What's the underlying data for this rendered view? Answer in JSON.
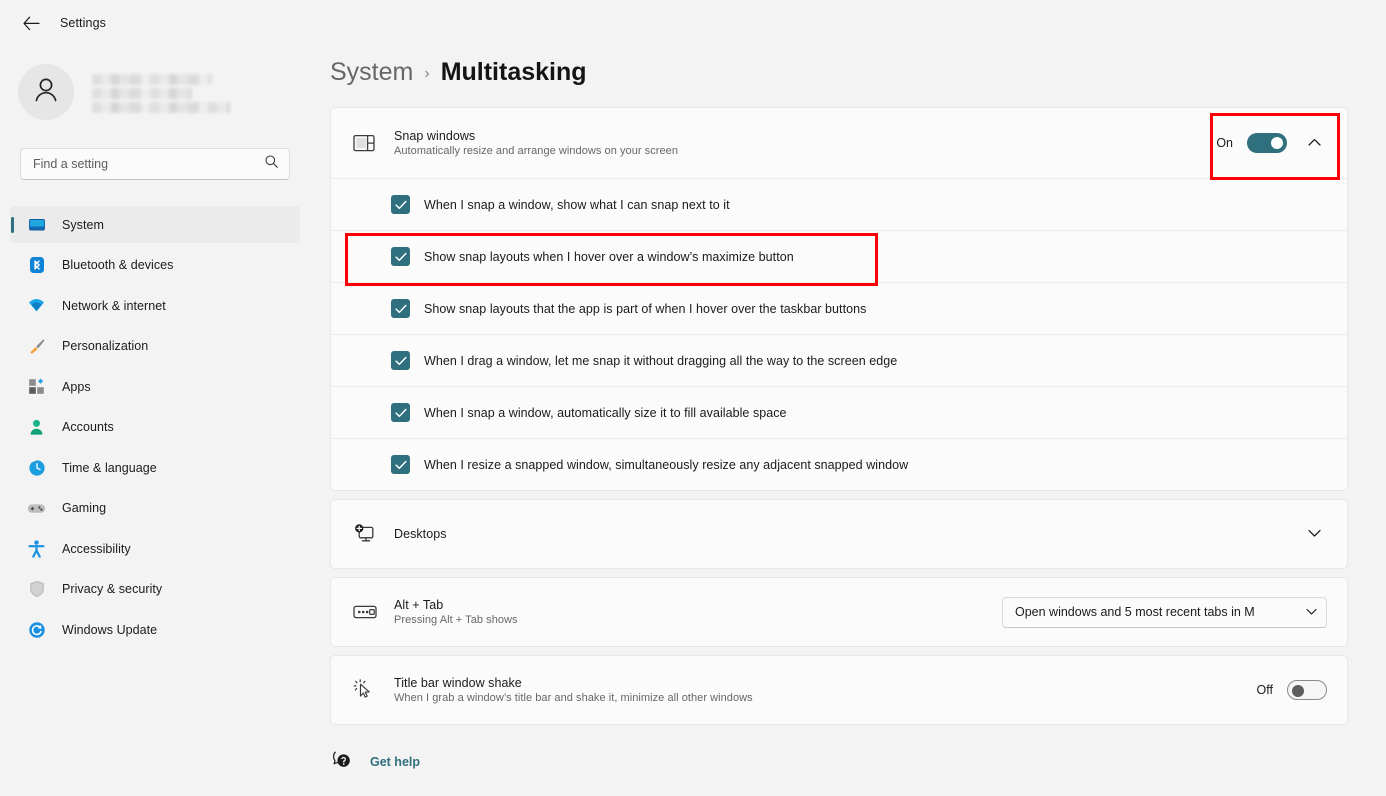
{
  "titlebar": {
    "back_icon": "arrow-left-icon",
    "title": "Settings"
  },
  "sidebar": {
    "profile": {
      "avatar_icon": "person-avatar-icon",
      "name_redacted": true
    },
    "search": {
      "placeholder": "Find a setting",
      "value": "",
      "icon": "search-icon"
    },
    "items": [
      {
        "label": "System",
        "icon": "monitor-icon",
        "selected": true
      },
      {
        "label": "Bluetooth & devices",
        "icon": "bluetooth-icon",
        "selected": false
      },
      {
        "label": "Network & internet",
        "icon": "wifi-icon",
        "selected": false
      },
      {
        "label": "Personalization",
        "icon": "paintbrush-icon",
        "selected": false
      },
      {
        "label": "Apps",
        "icon": "apps-grid-icon",
        "selected": false
      },
      {
        "label": "Accounts",
        "icon": "person-icon",
        "selected": false
      },
      {
        "label": "Time & language",
        "icon": "clock-icon",
        "selected": false
      },
      {
        "label": "Gaming",
        "icon": "gamepad-icon",
        "selected": false
      },
      {
        "label": "Accessibility",
        "icon": "accessibility-icon",
        "selected": false
      },
      {
        "label": "Privacy & security",
        "icon": "shield-icon",
        "selected": false
      },
      {
        "label": "Windows Update",
        "icon": "update-icon",
        "selected": false
      }
    ]
  },
  "breadcrumb": {
    "parent": "System",
    "separator": "›",
    "current": "Multitasking"
  },
  "snap": {
    "icon": "snap-layout-icon",
    "title": "Snap windows",
    "subtitle": "Automatically resize and arrange windows on your screen",
    "toggle_state": "On",
    "toggle_on": true,
    "expand_icon": "chevron-up-icon",
    "options": [
      {
        "label": "When I snap a window, show what I can snap next to it",
        "checked": true
      },
      {
        "label": "Show snap layouts when I hover over a window’s maximize button",
        "checked": true
      },
      {
        "label": "Show snap layouts that the app is part of when I hover over the taskbar buttons",
        "checked": true
      },
      {
        "label": "When I drag a window, let me snap it without dragging all the way to the screen edge",
        "checked": true
      },
      {
        "label": "When I snap a window, automatically size it to fill available space",
        "checked": true
      },
      {
        "label": "When I resize a snapped window, simultaneously resize any adjacent snapped window",
        "checked": true
      }
    ]
  },
  "desktops": {
    "icon": "desktops-icon",
    "title": "Desktops",
    "expand_icon": "chevron-down-icon"
  },
  "alttab": {
    "icon": "alt-tab-icon",
    "title": "Alt + Tab",
    "subtitle": "Pressing Alt + Tab shows",
    "dropdown_value": "Open windows and 5 most recent tabs in M",
    "dropdown_icon": "chevron-down-icon"
  },
  "shake": {
    "icon": "cursor-shake-icon",
    "title": "Title bar window shake",
    "subtitle": "When I grab a window’s title bar and shake it, minimize all other windows",
    "toggle_state": "Off",
    "toggle_on": false
  },
  "gethelp": {
    "icon": "help-bubble-icon",
    "label": "Get help"
  },
  "annotations": [
    {
      "name": "snap-toggle-highlight",
      "color": "#fb0007"
    },
    {
      "name": "snap-layouts-option-highlight",
      "color": "#fb0007"
    }
  ]
}
